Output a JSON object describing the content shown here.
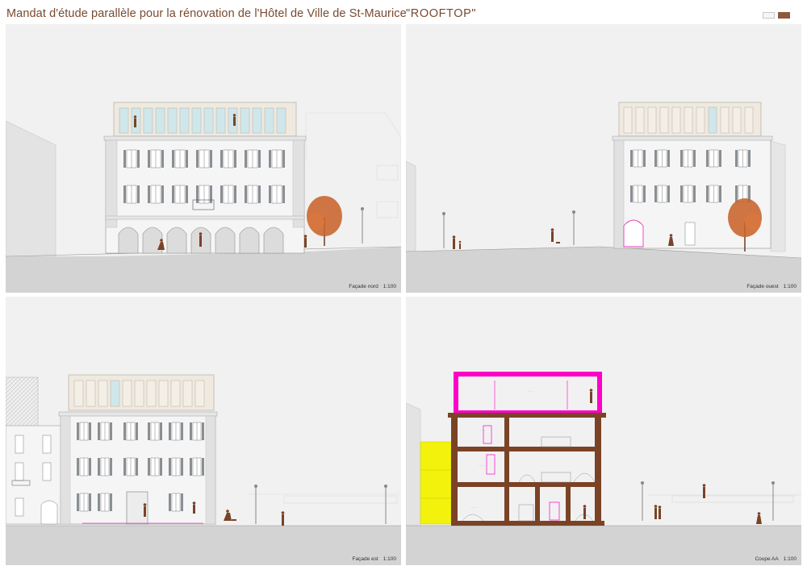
{
  "header": {
    "title": "Mandat d'étude parallèle pour la rénovation de l'Hôtel de Ville de St-Maurice",
    "project_name": "\"ROOFTOP\"",
    "pages": 2,
    "active_page": 2
  },
  "colors": {
    "panel_bg": "#f1f1f1",
    "ground": "#d2d2d2",
    "facade": "#f4f4f4",
    "rooftop_wood": "#efe8de",
    "glass": "#cfe8ec",
    "shutter": "#8a8f94",
    "figure": "#7a4326",
    "tree": "#c8632a",
    "section_wall": "#7a4326",
    "magenta": "#ff00c8",
    "yellow": "#f3f20d"
  },
  "panels": [
    {
      "id": "nord",
      "label": "Façade nord",
      "scale": "1:100"
    },
    {
      "id": "ouest",
      "label": "Façade ouest",
      "scale": "1:100"
    },
    {
      "id": "est",
      "label": "Façade est",
      "scale": "1:100"
    },
    {
      "id": "coupe",
      "label": "Coupe AA",
      "scale": "1:100"
    }
  ]
}
